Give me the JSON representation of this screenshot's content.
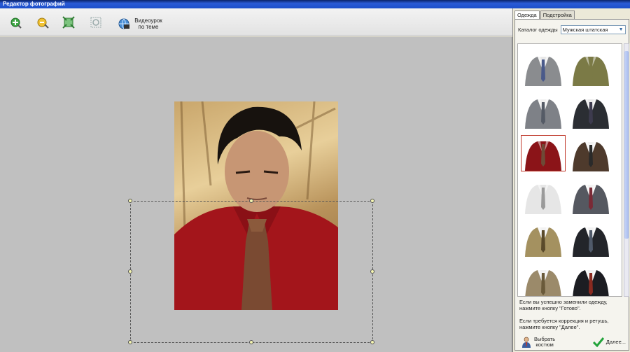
{
  "window": {
    "title": "Редактор фотографий"
  },
  "toolbar": {
    "buttons": [
      {
        "icon": "zoom-in-icon"
      },
      {
        "icon": "zoom-out-icon"
      },
      {
        "icon": "fit-to-window-icon"
      },
      {
        "icon": "actual-size-icon"
      }
    ],
    "video_label": "Видеоурок\nпо теме",
    "video_icon": "video-globe-icon"
  },
  "panel": {
    "tabs": [
      {
        "label": "Одежда",
        "active": true
      },
      {
        "label": "Подстройка",
        "active": false
      }
    ],
    "catalog_label": "Каталог одежды",
    "catalog_value": "Мужская штатская",
    "suits": [
      {
        "name": "grey-suit-1",
        "jacket": "#8a8c8f",
        "shirt": "#e8e8e8",
        "tie": "#4a5a8a"
      },
      {
        "name": "olive-sweater",
        "jacket": "#7b7a46",
        "shirt": "#7b7a46",
        "tie": "#7b7a46"
      },
      {
        "name": "grey-suit-2",
        "jacket": "#7e8187",
        "shirt": "#f0f0f0",
        "tie": "#555b66"
      },
      {
        "name": "dark-suit-1",
        "jacket": "#2b2e33",
        "shirt": "#e9e9e9",
        "tie": "#3d3b4e"
      },
      {
        "name": "red-shirt",
        "jacket": "#8b1418",
        "shirt": "#8b1418",
        "tie": "#6e4a36",
        "selected": true
      },
      {
        "name": "brown-suit",
        "jacket": "#4e3a2c",
        "shirt": "#f2f2f2",
        "tie": "#2a2a2a"
      },
      {
        "name": "white-shirt",
        "jacket": "#e6e6e6",
        "shirt": "#e6e6e6",
        "tie": "#9a9a9a"
      },
      {
        "name": "grey-suit-3",
        "jacket": "#555860",
        "shirt": "#f2f2f2",
        "tie": "#7a2a36"
      },
      {
        "name": "khaki-suit",
        "jacket": "#a49160",
        "shirt": "#f2f2f2",
        "tie": "#5a4a2a"
      },
      {
        "name": "black-suit-1",
        "jacket": "#23252a",
        "shirt": "#f2f2f2",
        "tie": "#505a6a"
      },
      {
        "name": "beige-suit",
        "jacket": "#9b8a6a",
        "shirt": "#f2f2f2",
        "tie": "#6a5a3a"
      },
      {
        "name": "black-suit-2",
        "jacket": "#1c1d22",
        "shirt": "#f2f2f2",
        "tie": "#8a2a20"
      }
    ],
    "info_done": "Если вы успешно заменили одежду, нажмите кнопку \"Готово\".",
    "info_next": "Если требуется коррекция и ретушь, нажмите кнопку \"Далее\".",
    "choose_suit_label": "Выбрать\nкостюм",
    "next_label": "Далее..."
  },
  "colors": {
    "canvas_bg": "#c0c0c0",
    "title_bar": "#2a5bd7",
    "next_check": "#22a33a"
  }
}
